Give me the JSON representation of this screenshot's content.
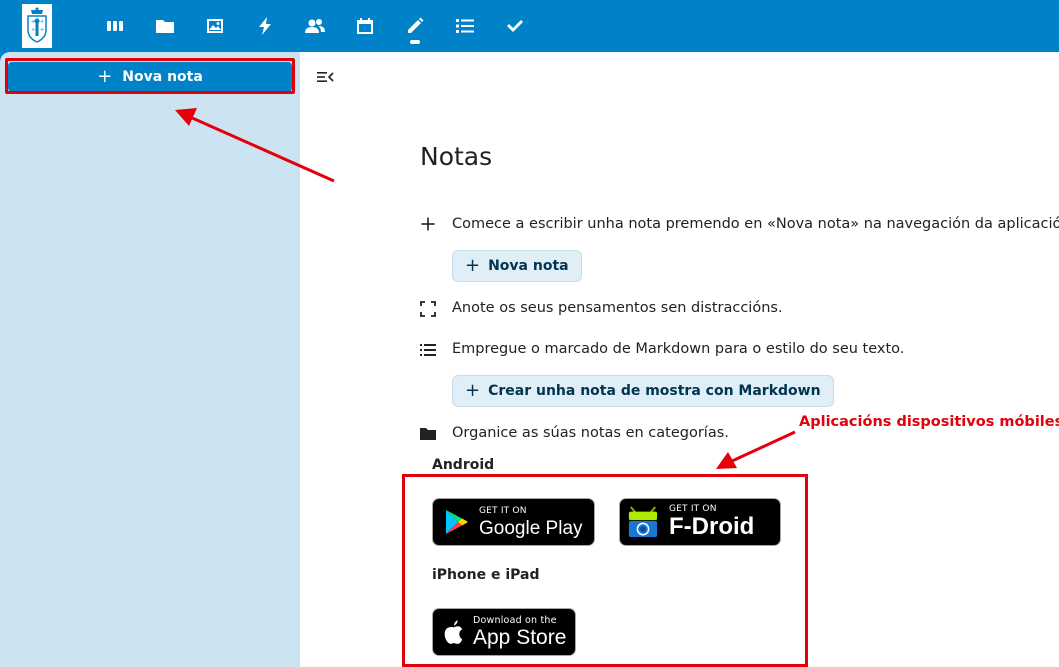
{
  "topbar": {
    "logo": "logo",
    "apps": [
      {
        "name": "dashboard-icon"
      },
      {
        "name": "files-icon"
      },
      {
        "name": "photos-icon"
      },
      {
        "name": "activity-icon"
      },
      {
        "name": "contacts-icon"
      },
      {
        "name": "calendar-icon"
      },
      {
        "name": "notes-icon"
      },
      {
        "name": "deck-icon"
      },
      {
        "name": "tasks-icon"
      }
    ]
  },
  "sidebar": {
    "new_note_label": "Nova nota"
  },
  "main": {
    "title": "Notas",
    "row1": "Comece a escribir unha nota premendo en «Nova nota» na navegación da aplicación.",
    "new_note_button": "Nova nota",
    "row2": "Anote os seus pensamentos sen distraccións.",
    "row3": "Empregue o marcado de Markdown para o estilo do seu texto.",
    "markdown_button": "Crear unha nota de mostra con Markdown",
    "row4": "Organice as súas notas en categorías.",
    "android_label": "Android",
    "ios_label": "iPhone e iPad",
    "google_play": {
      "small": "GET IT ON",
      "big": "Google Play"
    },
    "fdroid": {
      "small": "GET IT ON",
      "big": "F-Droid"
    },
    "appstore": {
      "small": "Download on the",
      "big": "App Store"
    }
  },
  "annotation": "Aplicacións dispositivos móbiles",
  "colors": {
    "brand": "#0082c9",
    "sidebar": "#cce4f2",
    "annotation_red": "#e3000b"
  }
}
